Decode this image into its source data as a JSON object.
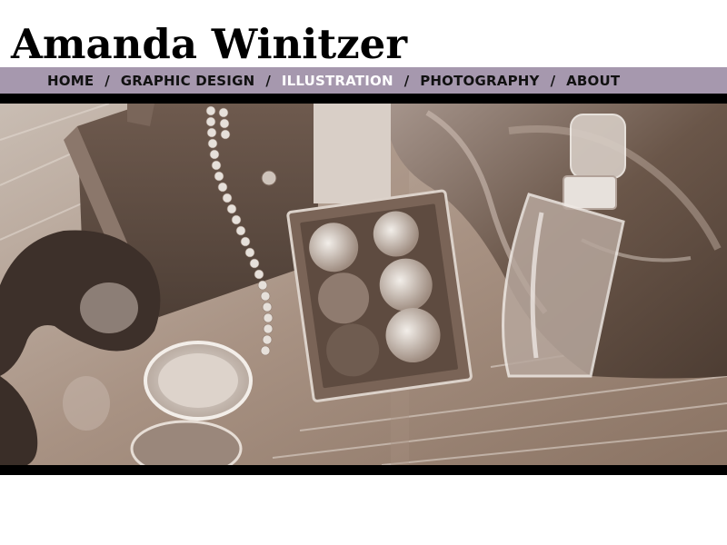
{
  "site": {
    "title": "Amanda Winitzer"
  },
  "nav": {
    "items": [
      {
        "label": "HOME",
        "active": false
      },
      {
        "label": "GRAPHIC DESIGN",
        "active": false
      },
      {
        "label": "ILLUSTRATION",
        "active": true
      },
      {
        "label": "PHOTOGRAPHY",
        "active": false
      },
      {
        "label": "ABOUT",
        "active": false
      }
    ],
    "separator": "/"
  },
  "colors": {
    "nav_background": "#a698ae",
    "nav_text": "#111111",
    "nav_active_text": "#ffffff",
    "bars": "#000000",
    "title": "#000000"
  },
  "artwork": {
    "subject": "charcoal-drawing-vanity-still-life-icon"
  }
}
